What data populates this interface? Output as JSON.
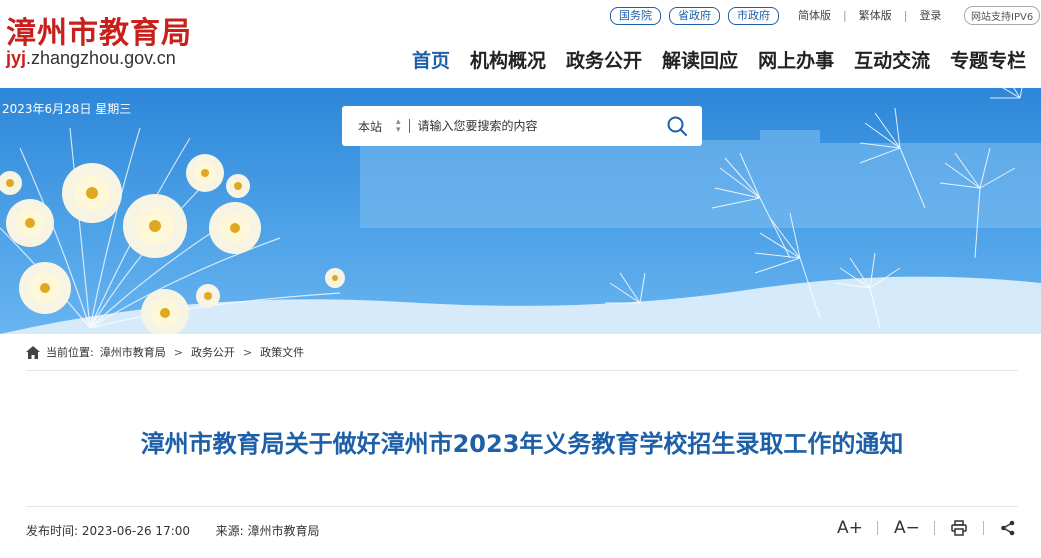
{
  "header": {
    "logo_cn": "漳州市教育局",
    "logo_url_prefix": "jyj",
    "logo_url_suffix": ".zhangzhou.gov.cn",
    "gov_links": [
      "国务院",
      "省政府",
      "市政府"
    ],
    "util_links": [
      "简体版",
      "繁体版",
      "登录"
    ],
    "ipv6": "网站支持IPV6",
    "nav": [
      "首页",
      "机构概况",
      "政务公开",
      "解读回应",
      "网上办事",
      "互动交流",
      "专题专栏"
    ],
    "nav_active_index": 0
  },
  "banner": {
    "date": "2023年6月28日 星期三"
  },
  "search": {
    "scope": "本站",
    "placeholder": "请输入您要搜索的内容"
  },
  "breadcrumb": {
    "label": "当前位置:",
    "items": [
      "漳州市教育局",
      "政务公开",
      "政策文件"
    ]
  },
  "article": {
    "title": "漳州市教育局关于做好漳州市2023年义务教育学校招生录取工作的通知",
    "publish_label": "发布时间:",
    "publish_time": "2023-06-26 17:00",
    "source_label": "来源:",
    "source": "漳州市教育局"
  },
  "tools": {
    "font_up": "A+",
    "font_down": "A−",
    "print_icon": "print-icon",
    "share_icon": "share-icon"
  },
  "colors": {
    "brand_red": "#c8201c",
    "brand_blue": "#1e5fa8",
    "banner_sky": "#4a9fe6"
  }
}
